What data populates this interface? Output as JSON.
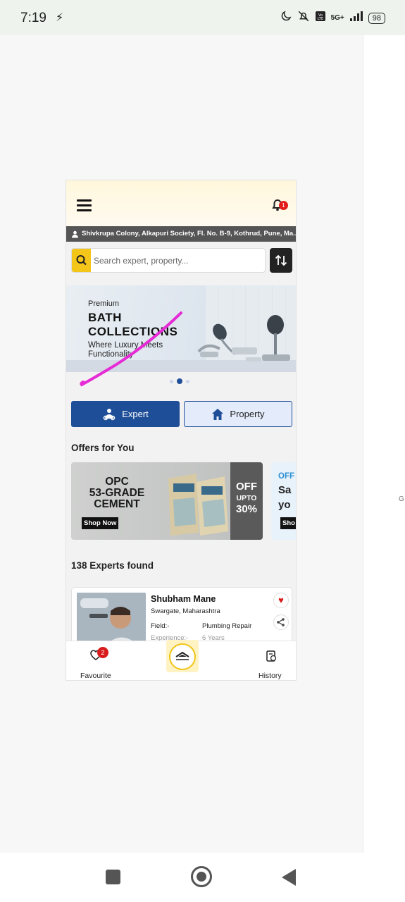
{
  "status_bar": {
    "time": "7:19",
    "network": "5G+",
    "battery": "98"
  },
  "app": {
    "address": "Shivkrupa Colony, Alkapuri Society,  Fl. No. B-9, Kothrud, Pune, Ma...",
    "notification_count": "1",
    "search": {
      "placeholder": "Search expert, property..."
    },
    "banner": {
      "premium": "Premium",
      "title_line1": "BATH",
      "title_line2": "COLLECTIONS",
      "subtitle_line1": "Where Luxury Meets",
      "subtitle_line2": "Functionality",
      "slides": 3,
      "active_slide": 2
    },
    "tabs": {
      "expert": "Expert",
      "property": "Property"
    },
    "offers": {
      "title": "Offers for You",
      "card1": {
        "line1": "OPC",
        "line2": "53-GRADE",
        "line3": "CEMENT",
        "cta": "Shop Now",
        "badge_off": "OFF",
        "badge_upto": "UPTO",
        "badge_pct": "30%"
      },
      "card2": {
        "off": "OFF",
        "line1": "Sa",
        "line2": "yo",
        "cta": "Sho"
      }
    },
    "experts": {
      "count_text": "138 Experts found",
      "card": {
        "name": "Shubham Mane",
        "location": "Swargate, Maharashtra",
        "field_label": "Field:-",
        "field_value": "Plumbing Repair",
        "experience_label": "Experience:-",
        "experience_value": "6 Years"
      }
    },
    "bottom_nav": {
      "favourite": "Favourite",
      "favourite_count": "2",
      "history": "History"
    }
  },
  "side_letter": "G",
  "colors": {
    "primary_blue": "#1f4e98",
    "accent_yellow": "#f5c61a",
    "badge_red": "#e31b1b",
    "scribble": "#e62bd6"
  }
}
